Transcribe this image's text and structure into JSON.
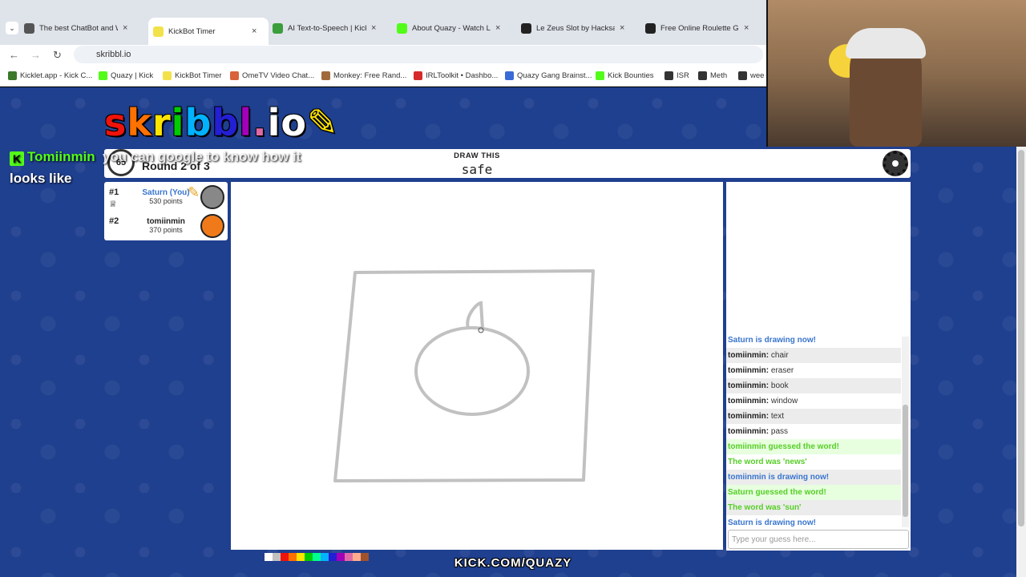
{
  "browser": {
    "tabs": [
      {
        "title": "The best ChatBot and W",
        "favicon_color": "#555555",
        "active": false
      },
      {
        "title": "KickBot Timer",
        "favicon_color": "#f2e24a",
        "active": true
      },
      {
        "title": "AI Text-to-Speech | Kick",
        "favicon_color": "#3a9e3a",
        "active": false
      },
      {
        "title": "About Quazy - Watch Liv",
        "favicon_color": "#53fc18",
        "active": false
      },
      {
        "title": "Le Zeus Slot by Hacksaw",
        "favicon_color": "#222222",
        "active": false
      },
      {
        "title": "Free Online Roulette Gam",
        "favicon_color": "#222222",
        "active": false
      }
    ],
    "tab_menu_icon": "chevron-down-icon",
    "url": "skribbl.io",
    "bookmarks": [
      {
        "label": "Kicklet.app - Kick C...",
        "color": "#3a7a2a"
      },
      {
        "label": "Quazy | Kick",
        "color": "#53fc18"
      },
      {
        "label": "KickBot Timer",
        "color": "#f2e24a"
      },
      {
        "label": "OmeTV Video Chat...",
        "color": "#d9623a"
      },
      {
        "label": "Monkey: Free Rand...",
        "color": "#a06a3a"
      },
      {
        "label": "IRLToolkit • Dashbo...",
        "color": "#d62a2a"
      },
      {
        "label": "Quazy Gang Brainst...",
        "color": "#3a6ad6"
      },
      {
        "label": "Kick Bounties",
        "color": "#53fc18"
      },
      {
        "label": "ISR",
        "color": "#333333"
      },
      {
        "label": "Meth",
        "color": "#333333"
      },
      {
        "label": "wee",
        "color": "#333333"
      }
    ]
  },
  "game": {
    "logo": "skribbl.io",
    "timer": "65",
    "round_label": "Round 2 of 3",
    "draw_label": "DRAW THIS",
    "draw_word": "safe",
    "players": [
      {
        "rank": "#1",
        "name": "Saturn (You)",
        "points": "530 points",
        "name_color": "#3975ce",
        "avatar_color": "#888888"
      },
      {
        "rank": "#2",
        "name": "tomiinmin",
        "points": "370 points",
        "name_color": "#222222",
        "avatar_color": "#f07a1a"
      }
    ],
    "chat": [
      {
        "type": "sys-blue",
        "text": "Saturn is drawing now!"
      },
      {
        "type": "guess",
        "user": "tomiinmin:",
        "text": "chair"
      },
      {
        "type": "guess",
        "user": "tomiinmin:",
        "text": "eraser"
      },
      {
        "type": "guess",
        "user": "tomiinmin:",
        "text": "book"
      },
      {
        "type": "guess",
        "user": "tomiinmin:",
        "text": "window"
      },
      {
        "type": "guess",
        "user": "tomiinmin:",
        "text": "text"
      },
      {
        "type": "guess",
        "user": "tomiinmin:",
        "text": "pass"
      },
      {
        "type": "sys-green",
        "text": "tomiinmin guessed the word!"
      },
      {
        "type": "sys-green",
        "text": "The word was 'news'"
      },
      {
        "type": "sys-blue",
        "text": "tomiinmin is drawing now!"
      },
      {
        "type": "sys-green",
        "text": "Saturn guessed the word!"
      },
      {
        "type": "sys-green",
        "text": "The word was 'sun'"
      },
      {
        "type": "sys-blue",
        "text": "Saturn is drawing now!"
      }
    ],
    "chat_placeholder": "Type your guess here...",
    "palette": [
      "#ffffff",
      "#c1c1c1",
      "#ef130b",
      "#ff7100",
      "#ffe400",
      "#00cc00",
      "#00ff91",
      "#00b2ff",
      "#231fd3",
      "#a300ba",
      "#df69a7",
      "#ffac8e",
      "#a0522d"
    ]
  },
  "overlay": {
    "chat_user": "Tomiinmin",
    "chat_text": "you can google to know how it",
    "chat_text_2": "looks like",
    "watermark": "KICK.COM/QUAZY"
  }
}
